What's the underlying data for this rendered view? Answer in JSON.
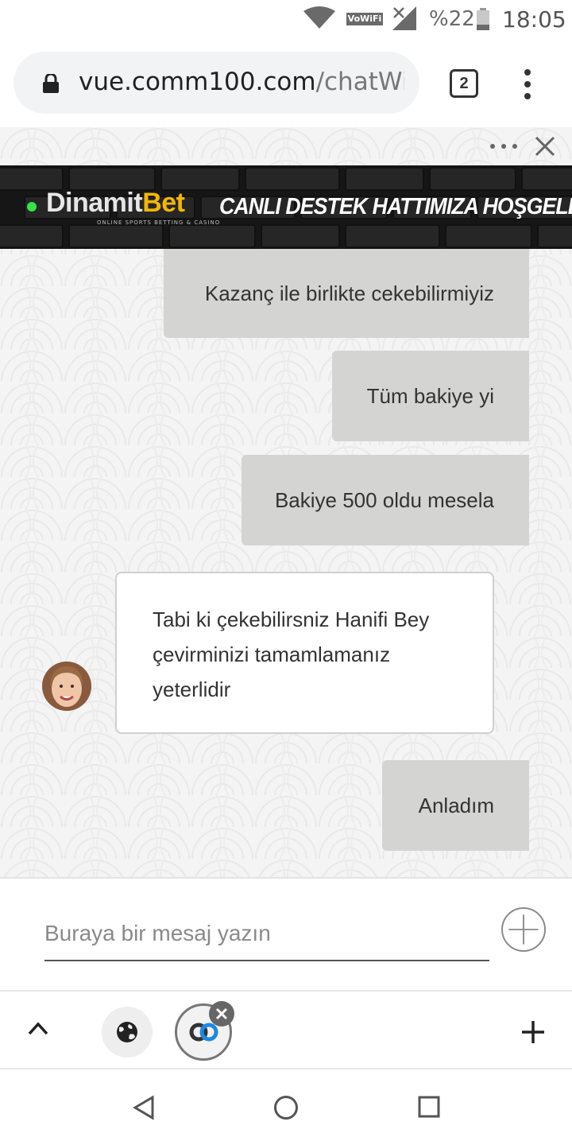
{
  "status_bar": {
    "vowifi": "VoWiFi",
    "battery": "%22",
    "time": "18:05"
  },
  "browser": {
    "url_host": "vue.comm100.com",
    "url_path": "/chatWin",
    "tab_count": "2"
  },
  "chat": {
    "banner": {
      "logo_main": "Dinamit",
      "logo_accent": "Bet",
      "logo_tagline": "ONLINE SPORTS BETTING & CASINO",
      "title": "CANLI DESTEK HATTIMIZA HOŞGELDİNİZ",
      "online_color": "#37e34a"
    },
    "messages": [
      {
        "from": "visitor",
        "text": "Kazanç ile birlikte cekebilirmiyiz"
      },
      {
        "from": "visitor",
        "text": "Tüm bakiye yi"
      },
      {
        "from": "visitor",
        "text": "Bakiye 500 oldu mesela"
      },
      {
        "from": "agent",
        "lines": [
          "Tabi ki çekebilirsniz Hanifi Bey",
          "çevirminizi tamamlamanız",
          "yeterlidir"
        ]
      },
      {
        "from": "visitor",
        "text": "Anladım"
      }
    ],
    "input": {
      "placeholder": "Buraya bir mesaj yazın"
    }
  },
  "colors": {
    "visitor_bubble": "#d4d4d2",
    "agent_bubble": "#ffffff",
    "logo_accent": "#f2b705"
  }
}
